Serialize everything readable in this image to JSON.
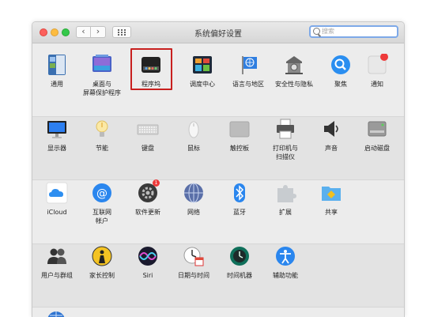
{
  "window": {
    "title": "系统偏好设置",
    "search_placeholder": "搜索",
    "nav_back": "‹",
    "nav_forward": "›"
  },
  "rows": [
    {
      "items": [
        {
          "id": "general",
          "label": "通用",
          "icon": "general-icon"
        },
        {
          "id": "desktop",
          "label": "桌面与\n屏幕保护程序",
          "icon": "desktop-screensaver-icon"
        },
        {
          "id": "dock",
          "label": "程序坞",
          "icon": "dock-icon",
          "highlighted": true
        },
        {
          "id": "mission",
          "label": "调度中心",
          "icon": "mission-control-icon"
        },
        {
          "id": "language",
          "label": "语言与地区",
          "icon": "language-region-icon"
        },
        {
          "id": "security",
          "label": "安全性与隐私",
          "icon": "security-privacy-icon"
        },
        {
          "id": "spotlight",
          "label": "聚焦",
          "icon": "spotlight-icon"
        },
        {
          "id": "notifications",
          "label": "通知",
          "icon": "notifications-icon"
        }
      ]
    },
    {
      "items": [
        {
          "id": "displays",
          "label": "显示器",
          "icon": "displays-icon"
        },
        {
          "id": "energy",
          "label": "节能",
          "icon": "energy-saver-icon"
        },
        {
          "id": "keyboard",
          "label": "键盘",
          "icon": "keyboard-icon"
        },
        {
          "id": "mouse",
          "label": "鼠标",
          "icon": "mouse-icon"
        },
        {
          "id": "trackpad",
          "label": "触控板",
          "icon": "trackpad-icon"
        },
        {
          "id": "printers",
          "label": "打印机与\n扫描仪",
          "icon": "printer-icon"
        },
        {
          "id": "sound",
          "label": "声音",
          "icon": "sound-icon"
        },
        {
          "id": "startup",
          "label": "启动磁盘",
          "icon": "startup-disk-icon"
        }
      ]
    },
    {
      "items": [
        {
          "id": "icloud",
          "label": "iCloud",
          "icon": "icloud-icon"
        },
        {
          "id": "internet",
          "label": "互联网\n帐户",
          "icon": "internet-accounts-icon"
        },
        {
          "id": "update",
          "label": "软件更新",
          "icon": "software-update-icon",
          "badge": "1"
        },
        {
          "id": "network",
          "label": "网络",
          "icon": "network-icon"
        },
        {
          "id": "bluetooth",
          "label": "蓝牙",
          "icon": "bluetooth-icon"
        },
        {
          "id": "extensions",
          "label": "扩展",
          "icon": "extensions-icon"
        },
        {
          "id": "sharing",
          "label": "共享",
          "icon": "sharing-icon"
        }
      ]
    },
    {
      "items": [
        {
          "id": "users",
          "label": "用户与群组",
          "icon": "users-groups-icon"
        },
        {
          "id": "parental",
          "label": "家长控制",
          "icon": "parental-controls-icon"
        },
        {
          "id": "siri",
          "label": "Siri",
          "icon": "siri-icon"
        },
        {
          "id": "datetime",
          "label": "日期与时间",
          "icon": "date-time-icon"
        },
        {
          "id": "timemachine",
          "label": "时间机器",
          "icon": "time-machine-icon"
        },
        {
          "id": "accessibility",
          "label": "辅助功能",
          "icon": "accessibility-icon"
        }
      ]
    }
  ],
  "colors": {
    "highlight_border": "#c8201f",
    "badge": "#ee3a3a"
  }
}
